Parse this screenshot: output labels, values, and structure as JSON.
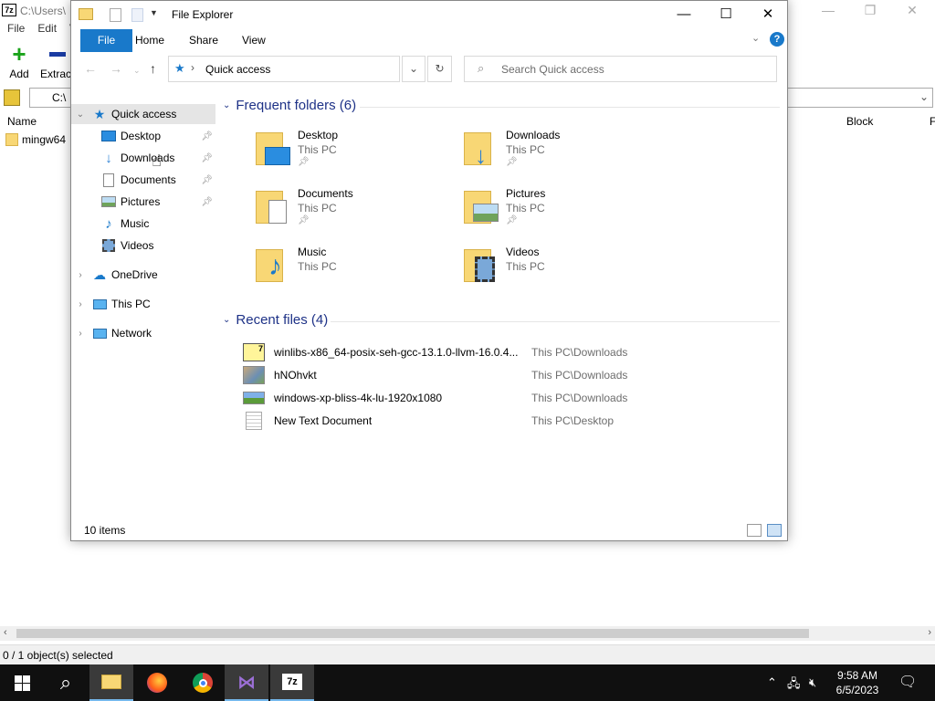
{
  "zip": {
    "title": "C:\\Users\\",
    "logo": "7z",
    "menu": [
      "File",
      "Edit",
      "V"
    ],
    "toolbar": {
      "add": "Add",
      "extract": "Extrac"
    },
    "address": "C:\\",
    "columns": {
      "name": "Name",
      "block": "Block",
      "f": "F"
    },
    "rows": [
      {
        "name": "mingw64"
      }
    ],
    "status": "0 / 1 object(s) selected"
  },
  "explorer": {
    "title": "File Explorer",
    "ribbon_tabs": {
      "file": "File",
      "home": "Home",
      "share": "Share",
      "view": "View"
    },
    "address": "Quick access",
    "search_placeholder": "Search Quick access",
    "nav": [
      {
        "label": "Quick access",
        "level": 0,
        "expanded": true,
        "selected": true,
        "icon": "star-icon"
      },
      {
        "label": "Desktop",
        "level": 1,
        "pinned": true,
        "icon": "desktop-icon"
      },
      {
        "label": "Downloads",
        "level": 1,
        "pinned": true,
        "icon": "download-icon",
        "hovered": true
      },
      {
        "label": "Documents",
        "level": 1,
        "pinned": true,
        "icon": "document-icon"
      },
      {
        "label": "Pictures",
        "level": 1,
        "pinned": true,
        "icon": "picture-icon"
      },
      {
        "label": "Music",
        "level": 1,
        "icon": "music-icon"
      },
      {
        "label": "Videos",
        "level": 1,
        "icon": "video-icon"
      },
      {
        "label": "OneDrive",
        "level": 0,
        "icon": "cloud-icon"
      },
      {
        "label": "This PC",
        "level": 0,
        "icon": "computer-icon"
      },
      {
        "label": "Network",
        "level": 0,
        "icon": "network-icon"
      }
    ],
    "frequent_header": "Frequent folders (6)",
    "frequent": [
      {
        "name": "Desktop",
        "sub": "This PC",
        "pinned": true,
        "overlay": "desktop"
      },
      {
        "name": "Downloads",
        "sub": "This PC",
        "pinned": true,
        "overlay": "download"
      },
      {
        "name": "Documents",
        "sub": "This PC",
        "pinned": true,
        "overlay": "document"
      },
      {
        "name": "Pictures",
        "sub": "This PC",
        "pinned": true,
        "overlay": "picture"
      },
      {
        "name": "Music",
        "sub": "This PC",
        "pinned": false,
        "overlay": "music"
      },
      {
        "name": "Videos",
        "sub": "This PC",
        "pinned": false,
        "overlay": "video"
      }
    ],
    "recent_header": "Recent files (4)",
    "recent": [
      {
        "name": "winlibs-x86_64-posix-seh-gcc-13.1.0-llvm-16.0.4...",
        "path": "This PC\\Downloads",
        "icon": "7z-archive-icon"
      },
      {
        "name": "hNOhvkt",
        "path": "This PC\\Downloads",
        "icon": "image-icon"
      },
      {
        "name": "windows-xp-bliss-4k-lu-1920x1080",
        "path": "This PC\\Downloads",
        "icon": "landscape-image-icon"
      },
      {
        "name": "New Text Document",
        "path": "This PC\\Desktop",
        "icon": "text-file-icon"
      }
    ],
    "status": "10 items"
  },
  "taskbar": {
    "time": "9:58 AM",
    "date": "6/5/2023"
  },
  "colors": {
    "accent": "#1979ca",
    "group_header": "#1e3287",
    "folder": "#f8d775",
    "taskbar": "#101010"
  }
}
